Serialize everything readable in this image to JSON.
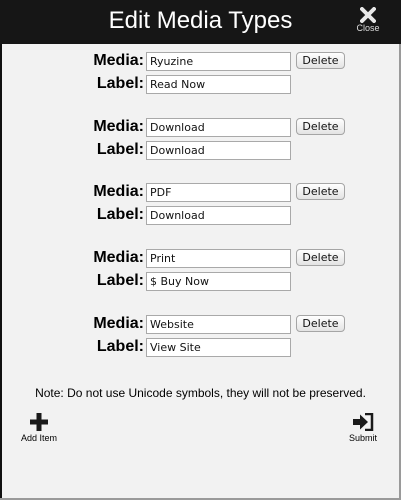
{
  "header": {
    "title": "Edit Media Types",
    "close_label": "Close"
  },
  "field_labels": {
    "media": "Media:",
    "label": "Label:"
  },
  "delete_label": "Delete",
  "media_items": [
    {
      "media": "Ryuzine",
      "label": "Read Now"
    },
    {
      "media": "Download",
      "label": "Download"
    },
    {
      "media": "PDF",
      "label": "Download"
    },
    {
      "media": "Print",
      "label": "$ Buy Now"
    },
    {
      "media": "Website",
      "label": "View Site"
    }
  ],
  "note": "Note: Do not use Unicode symbols, they will not be preserved.",
  "footer": {
    "add_label": "Add Item",
    "submit_label": "Submit"
  },
  "icons": {
    "close": "close-x-icon",
    "add": "plus-icon",
    "submit": "sign-in-icon"
  }
}
